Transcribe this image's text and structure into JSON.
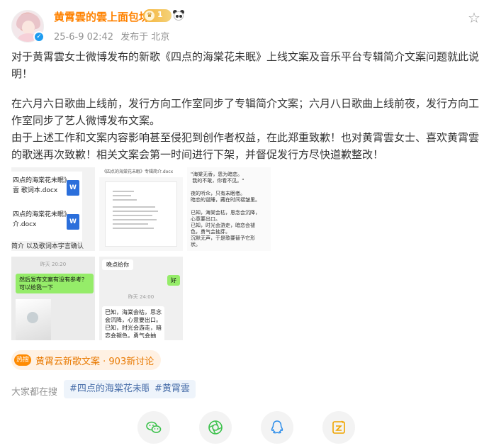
{
  "header": {
    "author": "黄霄雲的雲上面包坊",
    "level": "1",
    "timestamp": "25-6-9 02:42",
    "location": "发布于 北京"
  },
  "post": {
    "paragraphs": [
      "对于黄霄雲女士微博发布的新歌《四点的海棠花未眠》上线文案及音乐平台专辑简介文案问题就此说明！",
      "在六月六日歌曲上线前，发行方向工作室同步了专辑简介文案；六月八日歌曲上线前夜，发行方向工作室同步了艺人微博发布文案。",
      "由于上述工作和文案内容影响甚至侵犯到创作者权益，在此郑重致歉！也对黄霄雲女士、喜欢黄霄雲的歌迷再次致歉！相关文案会第一时间进行下架，并督促发行方尽快道歉整改！"
    ]
  },
  "images": {
    "img1": {
      "doc1_line1": "四点的海棠花未眠》",
      "doc1_line2": "雲 歌词本.docx",
      "doc2_line1": "四点的海棠花未眠》",
      "doc2_line2": "介.docx",
      "w_label": "W",
      "footer": "简介 以及歌词本宇言确认"
    },
    "img2": {
      "bar": "《四点的海棠花未眠》专辑简介.docx"
    },
    "img3": {
      "poem": "\"海棠无香，恩为暗恋。\n 我的不敢，你看不见。\"\n\n夜的听众，只有未眠者。\n暗恋的诞睡，藏在时间褶皱里。\n\n已知，海棠会枯，恩念会沉降，\n心意要出口。\n已知，时光会游走，暗恋会褪\n色，勇气会抽芽。\n沉默无声，于是歌要替予它形\n状。"
    },
    "img4": {
      "time": "昨天 20:20",
      "bubble": "然后发布文案有没有参考？可以给我一下"
    },
    "img5": {
      "top": "晚点给你",
      "ok": "好",
      "time": "昨天 24:00",
      "lyric": "已知，海棠会枯，思念会沉降，心意要出口。\n已知，时光会游走，暗恋会褪色，勇气会抽芽。\n沉默无声，于是歌要替予它形"
    }
  },
  "topic": {
    "hot_label": "热搜",
    "text": "黄霄云新歌文案 · 903新讨论"
  },
  "related": {
    "label": "大家都在搜",
    "tags": [
      "#四点的海棠花未眠",
      "#黄霄雲"
    ]
  },
  "share": {
    "icons": [
      "wechat-icon",
      "moments-icon",
      "qq-icon",
      "qzone-icon"
    ]
  },
  "colors": {
    "author": "#ff8200",
    "tag_text": "#486ea9",
    "topic_text": "#e87900",
    "meta": "#939393"
  }
}
